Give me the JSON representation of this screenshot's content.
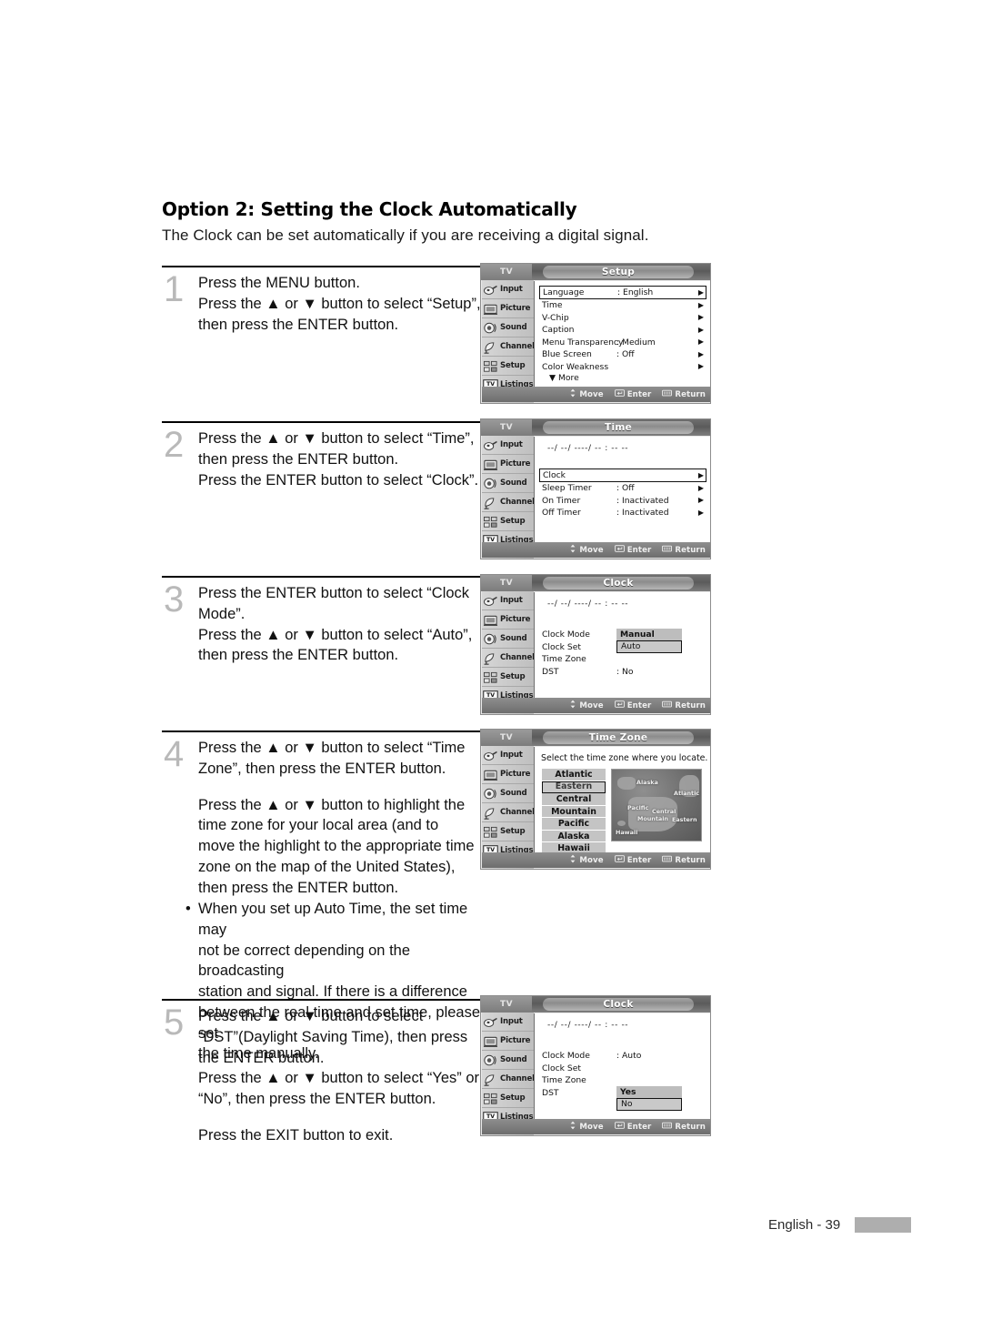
{
  "heading": "Option 2: Setting the Clock Automatically",
  "subheading": "The Clock can be set automatically if you are receiving a digital signal.",
  "steps": [
    {
      "num": "1",
      "lines": [
        "Press the MENU button.",
        "Press the ▲ or ▼ button to select “Setup”,",
        "then press the ENTER button."
      ]
    },
    {
      "num": "2",
      "lines": [
        "Press the ▲ or ▼ button to select “Time”,",
        "then press the ENTER button.",
        "Press the ENTER button to select “Clock”."
      ]
    },
    {
      "num": "3",
      "lines": [
        "Press the ENTER button to select “Clock",
        "Mode”.",
        "Press the ▲ or ▼ button to select “Auto”,",
        "then press the ENTER button."
      ]
    },
    {
      "num": "4",
      "lines_a": [
        "Press the ▲ or ▼ button to select “Time",
        "Zone”, then press the ENTER button."
      ],
      "lines_b": [
        "Press the ▲ or ▼ button to highlight the",
        "time zone for your local area (and to",
        "move the highlight to the appropriate time",
        "zone on the map of the United States),",
        "then press the ENTER button."
      ]
    },
    {
      "num": "5",
      "lines_a": [
        "Press the ▲ or ▼ button to select",
        "“DST”(Daylight Saving Time), then press",
        "the ENTER button.",
        "Press the ▲ or ▼ button to select “Yes” or",
        "“No”, then press the ENTER button."
      ],
      "lines_b": [
        "Press the EXIT button to exit."
      ]
    }
  ],
  "bullet": {
    "marker": "•",
    "lines": [
      "When you set up Auto Time, the set time may",
      "not be correct depending on the broadcasting",
      "station and signal. If there is a difference",
      "between the real time and set time, please set",
      "the time manually."
    ]
  },
  "osd_common": {
    "tv_label": "TV",
    "sidebar": [
      {
        "label": "Input",
        "icon": "input-jack-icon"
      },
      {
        "label": "Picture",
        "icon": "tv-screen-icon"
      },
      {
        "label": "Sound",
        "icon": "speaker-icon"
      },
      {
        "label": "Channel",
        "icon": "satellite-dish-icon"
      },
      {
        "label": "Setup",
        "icon": "setup-boxes-icon"
      },
      {
        "label": "Listings",
        "icon": "tv-guide-icon"
      }
    ],
    "bottombar": [
      {
        "label": "Move",
        "icon": "updown-arrow-icon"
      },
      {
        "label": "Enter",
        "icon": "enter-key-icon"
      },
      {
        "label": "Return",
        "icon": "return-key-icon"
      }
    ],
    "timestring": "--/ --/ ----/ -- : -- --",
    "arrow": "▶",
    "colors": {
      "osd_bg": "#e9e9e9",
      "osd_content": "#ffffff",
      "titlebar": "#5b5b5b",
      "sidebar": "#c8c8c8",
      "highlight_box": "#c9c9c9",
      "footer_bar": "#aeaeae"
    }
  },
  "osd_setup": {
    "title": "Setup",
    "rows": [
      {
        "name": "Language",
        "value": ": English",
        "arrow": true,
        "boxed": true
      },
      {
        "name": "Time",
        "value": "",
        "arrow": true,
        "boxed": false
      },
      {
        "name": "V-Chip",
        "value": "",
        "arrow": true,
        "boxed": false
      },
      {
        "name": "Caption",
        "value": "",
        "arrow": true,
        "boxed": false
      },
      {
        "name": "Menu Transparency",
        "value": ": Medium",
        "arrow": true,
        "boxed": false
      },
      {
        "name": "Blue Screen",
        "value": ": Off",
        "arrow": true,
        "boxed": false
      },
      {
        "name": "Color Weakness",
        "value": "",
        "arrow": true,
        "boxed": false
      }
    ],
    "more": "▼ More"
  },
  "osd_time": {
    "title": "Time",
    "rows": [
      {
        "name": "Clock",
        "value": "",
        "arrow": true,
        "boxed": true
      },
      {
        "name": "Sleep Timer",
        "value": ": Off",
        "arrow": true,
        "boxed": false
      },
      {
        "name": "On Timer",
        "value": ": Inactivated",
        "arrow": true,
        "boxed": false
      },
      {
        "name": "Off Timer",
        "value": ": Inactivated",
        "arrow": true,
        "boxed": false
      }
    ]
  },
  "osd_clock_mode": {
    "title": "Clock",
    "rows": [
      {
        "name": "Clock Mode",
        "value": "",
        "arrow": false,
        "boxed": false
      },
      {
        "name": "Clock Set",
        "value": "",
        "arrow": false,
        "boxed": false
      },
      {
        "name": "Time Zone",
        "value": "",
        "arrow": false,
        "boxed": false
      },
      {
        "name": "DST",
        "value": ": No",
        "arrow": false,
        "boxed": false
      }
    ],
    "selector": {
      "options": [
        "Manual",
        "Auto"
      ],
      "selected": "Auto"
    }
  },
  "osd_timezone": {
    "title": "Time Zone",
    "instruction": "Select the time zone where you locate.",
    "zones": [
      "Atlantic",
      "Eastern",
      "Central",
      "Mountain",
      "Pacific",
      "Alaska",
      "Hawaii"
    ],
    "selected": "Eastern",
    "map_labels": [
      "Alaska",
      "Atlantic",
      "Pacific",
      "Central",
      "Mountain",
      "Eastern",
      "Hawaii"
    ]
  },
  "osd_clock_dst": {
    "title": "Clock",
    "rows": [
      {
        "name": "Clock Mode",
        "value": ": Auto",
        "arrow": false,
        "boxed": false
      },
      {
        "name": "Clock Set",
        "value": "",
        "arrow": false,
        "boxed": false
      },
      {
        "name": "Time Zone",
        "value": "",
        "arrow": false,
        "boxed": false
      },
      {
        "name": "DST",
        "value": "",
        "arrow": false,
        "boxed": false
      }
    ],
    "selector": {
      "options": [
        "Yes",
        "No"
      ],
      "selected": "No"
    }
  },
  "footer": {
    "page_label": "English - 39"
  }
}
